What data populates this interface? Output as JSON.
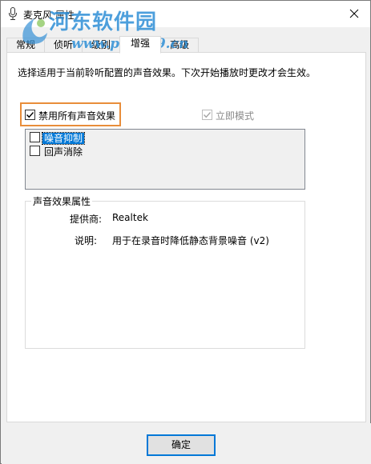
{
  "window": {
    "title": "麦克风 属性",
    "close_glyph": "✕"
  },
  "watermark": {
    "main": "河东软件园",
    "url": "www.pc0359.cn"
  },
  "tabs": [
    {
      "label": "常规",
      "active": false
    },
    {
      "label": "侦听",
      "active": false
    },
    {
      "label": "级别",
      "active": false
    },
    {
      "label": "增强",
      "active": true
    },
    {
      "label": "高级",
      "active": false
    }
  ],
  "enhancements": {
    "description": "选择适用于当前聆听配置的声音效果。下次开始播放时更改才会生效。",
    "disable_all_label": "禁用所有声音效果",
    "disable_all_checked": true,
    "immediate_mode_label": "立即模式",
    "immediate_mode_checked": true,
    "effects": [
      {
        "label": "噪音抑制",
        "checked": false,
        "selected": true
      },
      {
        "label": "回声消除",
        "checked": false,
        "selected": false
      }
    ]
  },
  "properties": {
    "group_title": "声音效果属性",
    "provider_key": "提供商:",
    "provider_value": "Realtek",
    "description_key": "说明:",
    "description_value": "用于在录音时降低静态背景噪音 (v2)"
  },
  "footer": {
    "ok_label": "确定"
  },
  "colors": {
    "accent": "#0078d7",
    "highlight_box": "#e88d3a",
    "watermark": "#2f8fd6"
  }
}
